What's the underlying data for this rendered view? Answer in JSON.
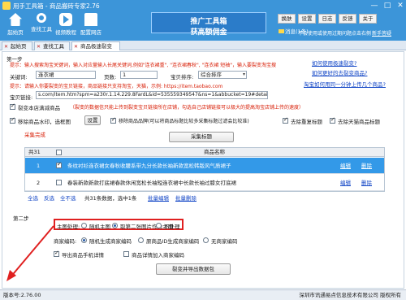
{
  "window": {
    "title": "用手工具箱 - 商品搬砖专家2.76",
    "controls": [
      "—",
      "□",
      "✕"
    ]
  },
  "toolbar": {
    "buttons": [
      "起始页",
      "查找工具",
      "视频教程",
      "配置网店"
    ],
    "icons": [
      "home-icon",
      "search-icon",
      "video-icon",
      "store-icon"
    ],
    "banner_line1": "推广工具箱",
    "banner_line2": "获高额佣金",
    "top_buttons": [
      "换肤",
      "设置",
      "日志",
      "反馈",
      "关于"
    ],
    "message_label": "消息(1条)",
    "notice_text": "不会使用或使用过期问题点击右侧",
    "new_version_link": "新手答疑"
  },
  "tabs": [
    "起始页",
    "查找工具",
    "商品极速裂变"
  ],
  "step1": {
    "title": "第一步",
    "hint1": "提示：输入搜索淘宝关键词，输入对应量输入长尾关键词,例如\"连衣裙重\", \"连衣裙春秋\", \"连衣裙 短袖\"，输入要裂变淘宝搜",
    "keyword_label": "关键词:",
    "keyword_value": "连衣裙",
    "pages_label": "页数:",
    "pages_value": "1",
    "sort_label": "宝贝排序:",
    "sort_value": "综合排序",
    "link1": "如何使用极速裂变?",
    "hint2": "提示：请输入你要裂变的宝贝链接，商品链接只支持淘宝，天猫，示例: https://item.taobao.com",
    "link2": "如何更好的去裂变商品?",
    "link3": "淘宝如何用同一分钟上传几个商品?",
    "url_label": "宝贝链接:",
    "url_value": "s.com/item.htm?spm=a230r.1.14.229.8FardL&id=535559349547&ns=1&abbucket=19#detail",
    "option1": "裂变本店满减商品",
    "option1_note": "（裂变的数据信只能上传到裂变宝贝链接所在店铺，勾选自己店铺链接可以极大的提高淘宝店铺上传的速度）",
    "option2": "移除商品水印，选框图",
    "settings_btn": "设置",
    "option3": "移除商品品牌(可以将商品标题比较多采集标题过滤会比较准)",
    "option4": "去除重复标题",
    "option5": "去除天猫商品标题",
    "collect_btn": "采集标题",
    "collect_status": "采集完成"
  },
  "grid": {
    "count_label": "共31",
    "headers": [
      "",
      "商品名称",
      "",
      ""
    ],
    "rows": [
      {
        "num": "1",
        "checked": true,
        "name": "条纹衬衫连衣裙女春秋收腰系带九分长款长袖新款宽松韩版风气质裙子",
        "edit": "编辑",
        "del": "删除"
      },
      {
        "num": "2",
        "checked": false,
        "name": "春装新款新款打底裙春款休闲宽松长袖短连衣裙中长款长袖过膝女打底裙",
        "edit": "编辑",
        "del": "删除"
      }
    ],
    "select_all": "全选",
    "invert": "反选",
    "select_none": "全不选",
    "summary": "共31条数据，选中1条",
    "batch_edit": "批量编辑",
    "batch_delete": "批量删除"
  },
  "step2": {
    "title": "第二步",
    "main_image_label": "主图处理:",
    "main_image_options": [
      "随机主图",
      "取第二张图片作为主图",
      "不处理"
    ],
    "main_image_selected": 1,
    "outer_code_label": "商家编码:",
    "outer_code_options": [
      "随机生成商家编码",
      "原商品ID生成商家编码",
      "无商家编码"
    ],
    "outer_code_selected": 0,
    "export_option": "导出商品手机详情",
    "detail_option": "商品详情加入商家编码",
    "submit_btn": "裂变并导出数据包"
  },
  "status": {
    "version": "版本号:2.76.00",
    "company": "深圳市讯通易点信息技术有限公司 版权所有"
  },
  "colors": {
    "titlebar": "#3c95d9",
    "selected_row": "#3399e8",
    "highlight": "#e02020",
    "hint_red": "#d81e06"
  }
}
